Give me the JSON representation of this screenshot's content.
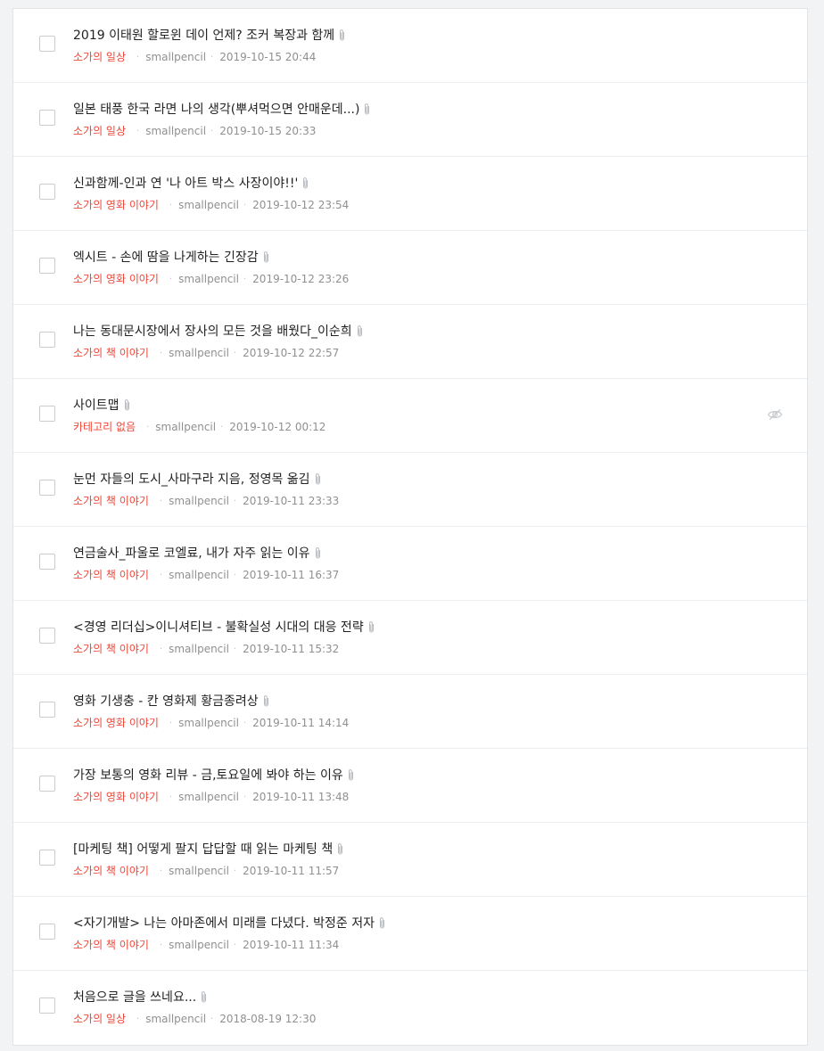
{
  "posts": [
    {
      "title": "2019 이태원 할로윈 데이 언제? 조커 복장과 함께",
      "category": "소가의 일상",
      "author": "smallpencil",
      "date": "2019-10-15 20:44",
      "attachment_icon": "paperclip-icon"
    },
    {
      "title": "일본 태풍 한국 라면 나의 생각(뿌셔먹으면 안매운데...)",
      "category": "소가의 일상",
      "author": "smallpencil",
      "date": "2019-10-15 20:33",
      "attachment_icon": "paperclip-icon"
    },
    {
      "title": "신과함께-인과 연 '나 아트 박스 사장이야!!'",
      "category": "소가의 영화 이야기",
      "author": "smallpencil",
      "date": "2019-10-12 23:54",
      "attachment_icon": "paperclip-icon"
    },
    {
      "title": "엑시트 - 손에 땀을 나게하는 긴장감",
      "category": "소가의 영화 이야기",
      "author": "smallpencil",
      "date": "2019-10-12 23:26",
      "attachment_icon": "paperclip-icon"
    },
    {
      "title": "나는 동대문시장에서 장사의 모든 것을 배웠다_이순희",
      "category": "소가의 책 이야기",
      "author": "smallpencil",
      "date": "2019-10-12 22:57",
      "attachment_icon": "paperclip-icon"
    },
    {
      "title": "사이트맵",
      "category": "카테고리 없음",
      "author": "smallpencil",
      "date": "2019-10-12 00:12",
      "attachment_icon": "paperclip-icon",
      "private_icon": "eye-slash-icon"
    },
    {
      "title": "눈먼 자들의 도시_사마구라 지음, 정영목 옮김",
      "category": "소가의 책 이야기",
      "author": "smallpencil",
      "date": "2019-10-11 23:33",
      "attachment_icon": "paperclip-icon"
    },
    {
      "title": "연금술사_파울로 코엘료, 내가 자주 읽는 이유",
      "category": "소가의 책 이야기",
      "author": "smallpencil",
      "date": "2019-10-11 16:37",
      "attachment_icon": "paperclip-icon"
    },
    {
      "title": "<경영 리더십>이니셔티브 - 불확실성 시대의 대응 전략",
      "category": "소가의 책 이야기",
      "author": "smallpencil",
      "date": "2019-10-11 15:32",
      "attachment_icon": "paperclip-icon"
    },
    {
      "title": "영화 기생충 - 칸 영화제 황금종려상",
      "category": "소가의 영화 이야기",
      "author": "smallpencil",
      "date": "2019-10-11 14:14",
      "attachment_icon": "paperclip-icon"
    },
    {
      "title": "가장 보통의 영화 리뷰 - 금,토요일에 봐야 하는 이유",
      "category": "소가의 영화 이야기",
      "author": "smallpencil",
      "date": "2019-10-11 13:48",
      "attachment_icon": "paperclip-icon"
    },
    {
      "title": "[마케팅 책] 어떻게 팔지 답답할 때 읽는 마케팅 책",
      "category": "소가의 책 이야기",
      "author": "smallpencil",
      "date": "2019-10-11 11:57",
      "attachment_icon": "paperclip-icon"
    },
    {
      "title": "<자기개발> 나는 아마존에서 미래를 다녔다. 박정준 저자",
      "category": "소가의 책 이야기",
      "author": "smallpencil",
      "date": "2019-10-11 11:34",
      "attachment_icon": "paperclip-icon"
    },
    {
      "title": "처음으로 글을 쓰네요...",
      "category": "소가의 일상",
      "author": "smallpencil",
      "date": "2018-08-19 12:30",
      "attachment_icon": "paperclip-icon"
    }
  ],
  "colors": {
    "category": "#ef4638",
    "title": "#222222",
    "meta": "#909090",
    "background": "#f1f3f5"
  }
}
